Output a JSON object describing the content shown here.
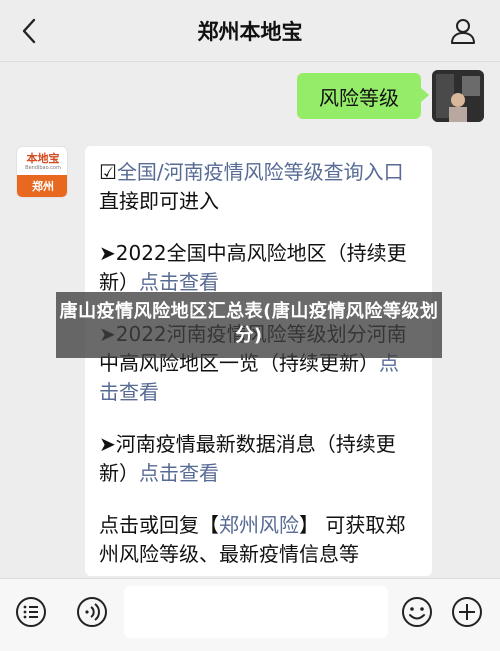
{
  "header": {
    "title": "郑州本地宝",
    "back_icon": "chevron-left-icon",
    "user_icon": "user-icon"
  },
  "chat": {
    "sent": {
      "text": "风险等级"
    },
    "bot": {
      "logo_text": "本地宝",
      "logo_url": "Bendibao.com",
      "logo_city": "郑州"
    },
    "received": {
      "p1": {
        "checkbox": "☑",
        "link": "全国/河南疫情风险等级查询入口",
        "text": "直接即可进入"
      },
      "p2": {
        "text": "➤2022全国中高风险地区（持续更新）",
        "link": "点击查看"
      },
      "p3": {
        "text": "➤2022河南疫情风险等级划分河南中高风险地区一览（持续更新）",
        "link": "点击查看"
      },
      "p4": {
        "text": "➤河南疫情最新数据消息（持续更新）",
        "link": "点击查看"
      },
      "p5": {
        "pre": "点击或回复【",
        "link": "郑州风险",
        "post": "】 可获取郑州风险等级、最新疫情信息等"
      }
    }
  },
  "overlay": {
    "text": "唐山疫情风险地区汇总表(唐山疫情风险等级划分)"
  },
  "input_bar": {
    "menu_icon": "menu-list-icon",
    "voice_icon": "voice-icon",
    "emoji_icon": "emoji-icon",
    "plus_icon": "plus-icon"
  }
}
